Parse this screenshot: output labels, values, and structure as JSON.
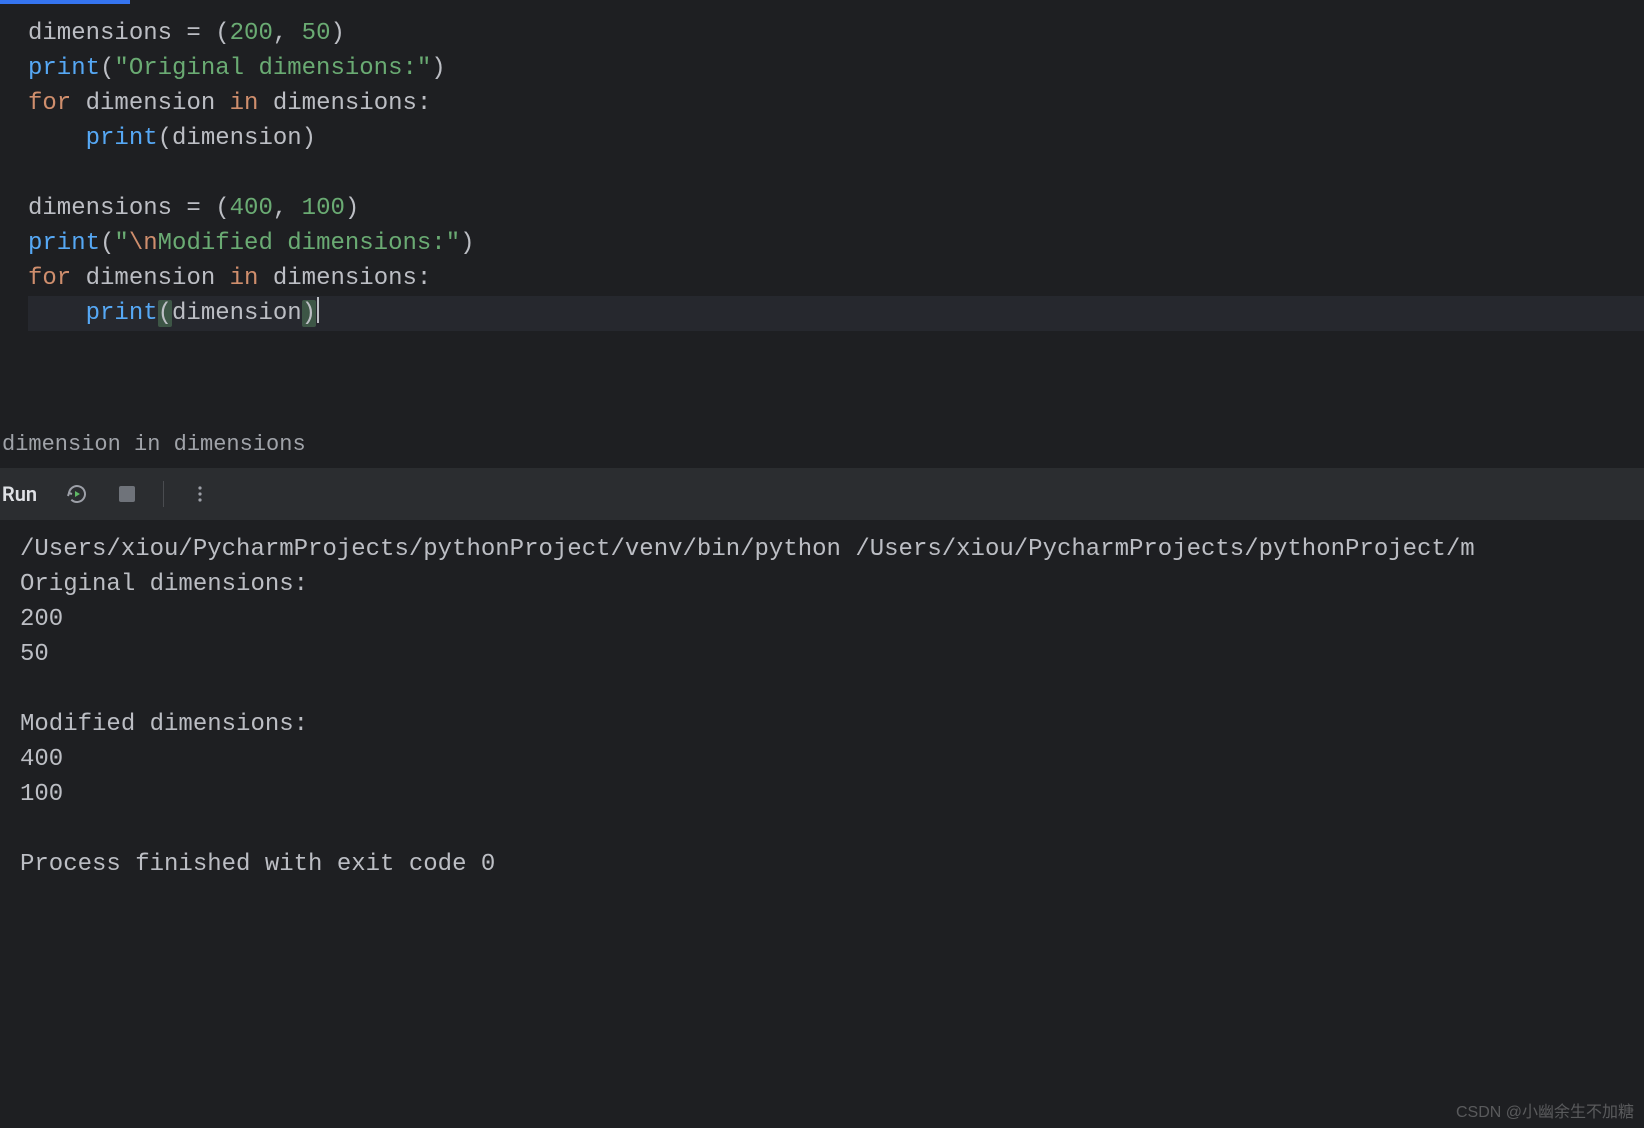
{
  "editor": {
    "lines": [
      {
        "kind": "assign",
        "var": "dimensions",
        "op": " = (",
        "nums": [
          "200",
          "50"
        ],
        "close": ")"
      },
      {
        "kind": "print_str",
        "fn": "print",
        "open": "(",
        "str": "\"Original dimensions:\"",
        "close": ")"
      },
      {
        "kind": "for",
        "kw1": "for",
        "v": "dimension",
        "kw2": "in",
        "it": "dimensions",
        "colon": ":"
      },
      {
        "kind": "print_var",
        "indent": "    ",
        "fn": "print",
        "open": "(",
        "arg": "dimension",
        "close": ")"
      },
      {
        "kind": "blank"
      },
      {
        "kind": "assign",
        "var": "dimensions",
        "op": " = (",
        "nums": [
          "400",
          "100"
        ],
        "close": ")"
      },
      {
        "kind": "print_str_esc",
        "fn": "print",
        "open": "(",
        "q": "\"",
        "esc": "\\n",
        "rest": "Modified dimensions:\"",
        "close": ")"
      },
      {
        "kind": "for",
        "kw1": "for",
        "v": "dimension",
        "kw2": "in",
        "it": "dimensions",
        "colon": ":"
      },
      {
        "kind": "print_var_cursor",
        "indent": "    ",
        "fn": "print",
        "open": "(",
        "arg": "dimension",
        "close": ")"
      }
    ]
  },
  "breadcrumb": "dimension in dimensions",
  "toolbar": {
    "run_label": "Run"
  },
  "console": {
    "lines": [
      "/Users/xiou/PycharmProjects/pythonProject/venv/bin/python /Users/xiou/PycharmProjects/pythonProject/m",
      "Original dimensions:",
      "200",
      "50",
      "",
      "Modified dimensions:",
      "400",
      "100",
      "",
      "Process finished with exit code 0"
    ]
  },
  "watermark": "CSDN @小幽余生不加糖"
}
